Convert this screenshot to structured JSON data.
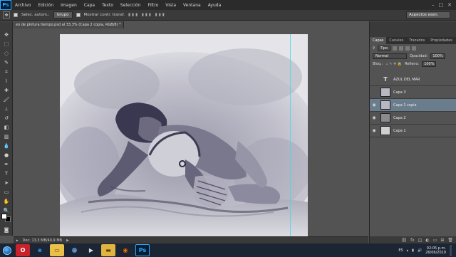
{
  "app": {
    "logo_text": "Ps"
  },
  "menubar": {
    "items": [
      "Archivo",
      "Edición",
      "Imagen",
      "Capa",
      "Texto",
      "Selección",
      "Filtro",
      "Vista",
      "Ventana",
      "Ayuda"
    ]
  },
  "options_bar": {
    "auto_select_label": "Selec. autom.:",
    "auto_select_value": "Grupo",
    "show_transform_label": "Mostrar contr. transf.",
    "workspace_value": "Aspectos esen."
  },
  "document": {
    "tab_title": "eo de pintura tiempo.psd al 33,3% (Capa 2 copia, RGB/8) *",
    "status_text": "Doc: 13,3 MB/40,9 MB"
  },
  "layers_panel": {
    "tabs": [
      "Capas",
      "Canales",
      "Trazados",
      "Propiedades"
    ],
    "active_tab": "Capas",
    "filter_label": "Tipo",
    "blend_mode": "Normal",
    "opacity_label": "Opacidad:",
    "opacity_value": "100%",
    "lock_label": "Bloq.:",
    "fill_label": "Relleno:",
    "fill_value": "100%",
    "layers": [
      {
        "name": "AZUL DEL MAR",
        "kind": "text",
        "visible": false,
        "active": false
      },
      {
        "name": "Capa 3",
        "kind": "sketch",
        "visible": false,
        "active": false
      },
      {
        "name": "Capa 1 copia",
        "kind": "sketch",
        "visible": true,
        "active": true
      },
      {
        "name": "Capa 2",
        "kind": "gray",
        "visible": true,
        "active": false
      },
      {
        "name": "Capa 1",
        "kind": "light",
        "visible": true,
        "active": false
      }
    ]
  },
  "taskbar": {
    "language": "ES",
    "time": "02:05 p.m.",
    "date": "26/06/2019",
    "ps_label": "Ps"
  }
}
